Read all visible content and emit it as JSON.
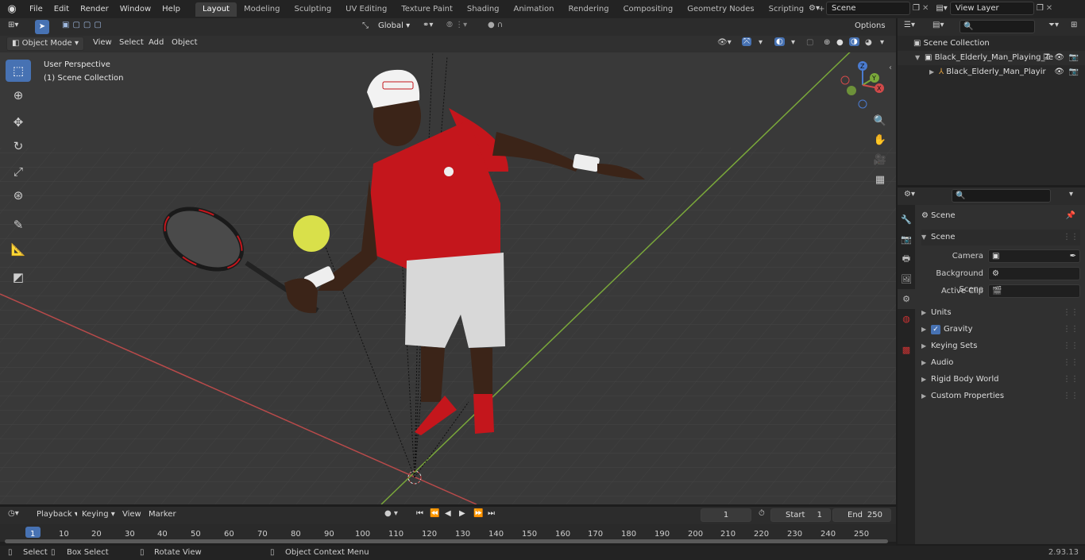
{
  "menu": [
    "File",
    "Edit",
    "Render",
    "Window",
    "Help"
  ],
  "workspaces": [
    "Layout",
    "Modeling",
    "Sculpting",
    "UV Editing",
    "Texture Paint",
    "Shading",
    "Animation",
    "Rendering",
    "Compositing",
    "Geometry Nodes",
    "Scripting"
  ],
  "active_workspace": "Layout",
  "add_tab": "+",
  "scene_field": "Scene",
  "view_layer_field": "View Layer",
  "viewport_header": {
    "mode": "Object Mode",
    "menus": [
      "View",
      "Select",
      "Add",
      "Object"
    ],
    "orientation": "Global",
    "options": "Options"
  },
  "overlay_text": {
    "perspective": "User Perspective",
    "collection": "(1) Scene Collection"
  },
  "gizmo": {
    "z": "Z",
    "y": "Y",
    "x": "X"
  },
  "outliner": {
    "search_placeholder": "",
    "rows": [
      {
        "label": "Scene Collection",
        "level": 0
      },
      {
        "label": "Black_Elderly_Man_Playing_Te",
        "level": 1
      },
      {
        "label": "Black_Elderly_Man_Playir",
        "level": 2
      }
    ]
  },
  "properties": {
    "header": "Scene",
    "panel": "Scene",
    "fields": [
      {
        "label": "Camera",
        "value": ""
      },
      {
        "label": "Background Scene",
        "value": ""
      },
      {
        "label": "Active Clip",
        "value": ""
      }
    ],
    "subpanels": [
      "Units",
      "Gravity",
      "Keying Sets",
      "Audio",
      "Rigid Body World",
      "Custom Properties"
    ],
    "gravity_checked": true
  },
  "timeline": {
    "menus": [
      "Playback",
      "Keying",
      "View",
      "Marker"
    ],
    "current_frame": "1",
    "start_label": "Start",
    "start_value": "1",
    "end_label": "End",
    "end_value": "250",
    "ticks": [
      "1",
      "10",
      "20",
      "30",
      "40",
      "50",
      "60",
      "70",
      "80",
      "90",
      "100",
      "110",
      "120",
      "130",
      "140",
      "150",
      "160",
      "170",
      "180",
      "190",
      "200",
      "210",
      "220",
      "230",
      "240",
      "250"
    ]
  },
  "status_bar": {
    "select": "Select",
    "box_select": "Box Select",
    "rotate_view": "Rotate View",
    "context_menu": "Object Context Menu",
    "version": "2.93.13"
  },
  "colors": {
    "accent": "#4772b3",
    "x_axis": "#b84a4a",
    "y_axis": "#7aa83a",
    "shirt": "#c4161c",
    "shorts": "#d8d8d8",
    "ball": "#d9e04a"
  }
}
